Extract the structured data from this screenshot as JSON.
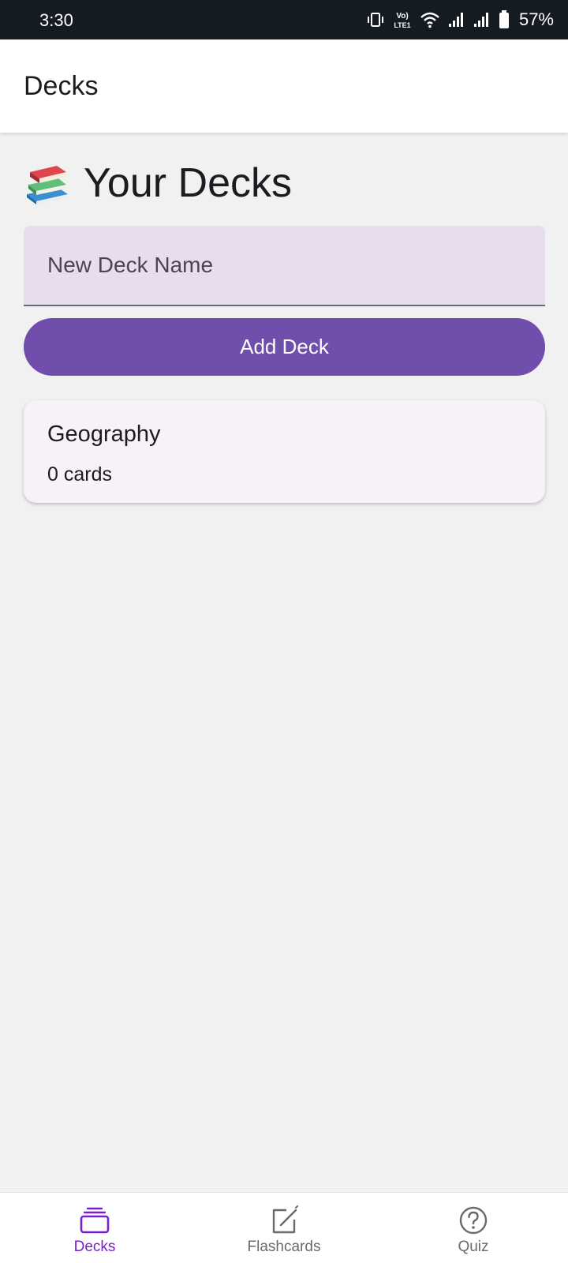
{
  "status_bar": {
    "time": "3:30",
    "battery_percent": "57%",
    "icons": [
      "vibrate-icon",
      "volte-icon",
      "wifi-icon",
      "signal-icon",
      "signal-icon",
      "battery-icon"
    ],
    "volte_label": "Vo) LTE1"
  },
  "app_bar": {
    "title": "Decks"
  },
  "main": {
    "heading_icon": "books-icon",
    "heading": "Your Decks",
    "new_deck_input": {
      "placeholder": "New Deck Name",
      "value": ""
    },
    "add_button_label": "Add Deck",
    "decks": [
      {
        "name": "Geography",
        "count_label": "0 cards"
      }
    ]
  },
  "bottom_nav": {
    "items": [
      {
        "label": "Decks",
        "icon": "decks-icon",
        "selected": true
      },
      {
        "label": "Flashcards",
        "icon": "edit-note-icon",
        "selected": false
      },
      {
        "label": "Quiz",
        "icon": "help-circle-icon",
        "selected": false
      }
    ]
  },
  "colors": {
    "accent": "#6f4fab",
    "nav_selected": "#7b1fd0",
    "nav_unselected": "#6a6a6a",
    "input_background": "#e8dded",
    "card_background": "#f7f1f8",
    "status_bar_background": "#141b22",
    "page_background": "#f1f1f1"
  }
}
